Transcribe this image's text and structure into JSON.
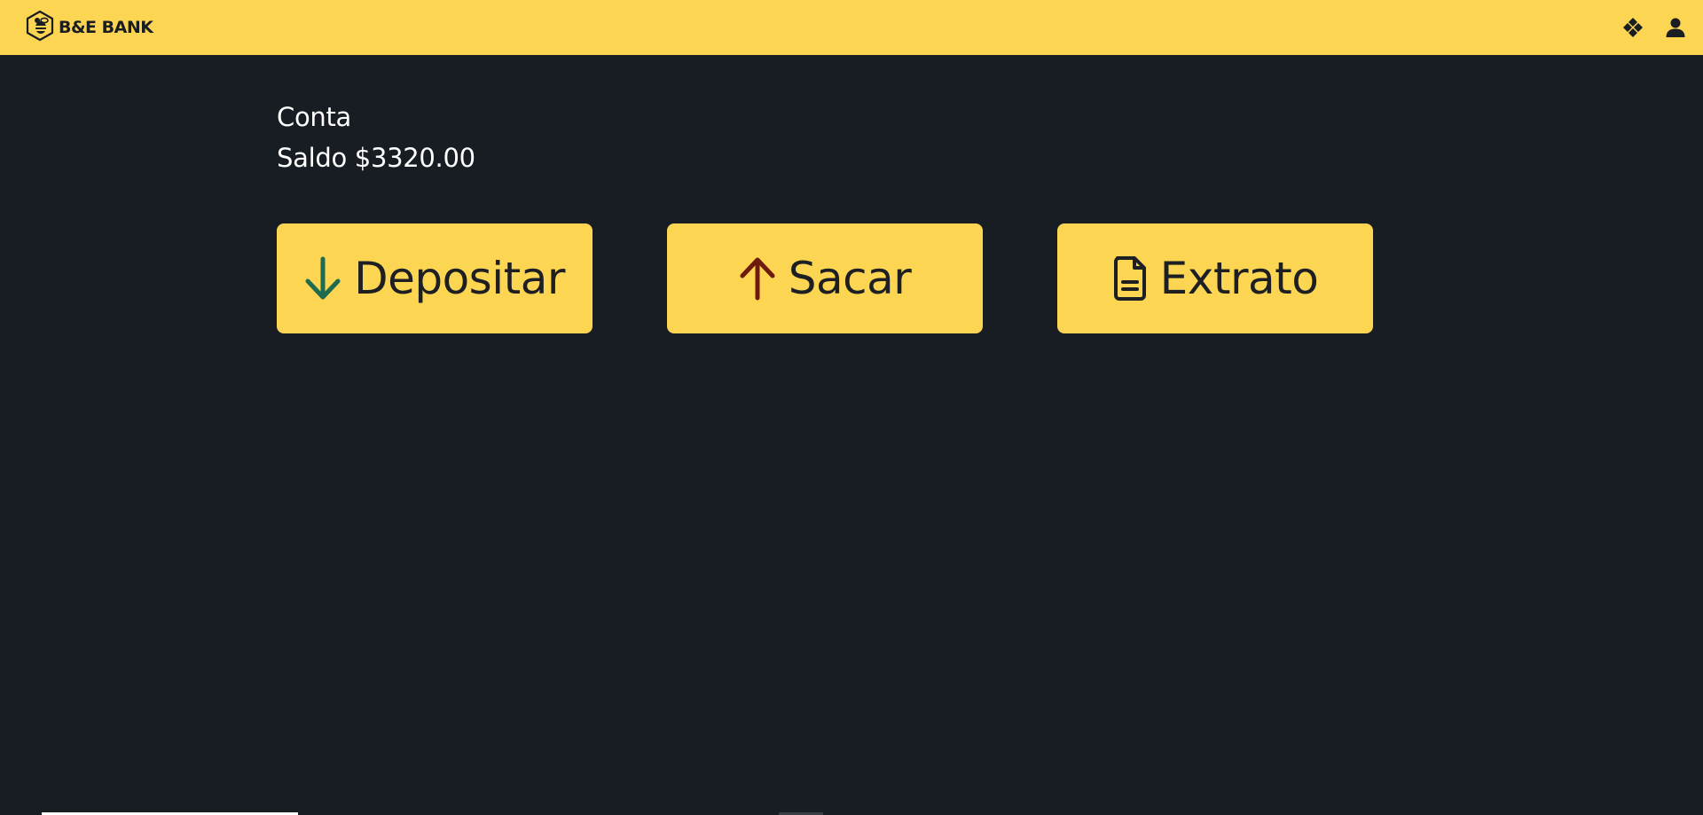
{
  "navbar": {
    "brand_text": "B&E BANK",
    "icons": [
      "diamonds-icon",
      "user-icon"
    ]
  },
  "account": {
    "title": "Conta",
    "balance_label": "Saldo $3320.00"
  },
  "actions": [
    {
      "label": "Depositar",
      "icon": "arrow-down-icon",
      "icon_color": "#1f6b4f"
    },
    {
      "label": "Sacar",
      "icon": "arrow-up-icon",
      "icon_color": "#6e1a0d"
    },
    {
      "label": "Extrato",
      "icon": "document-icon",
      "icon_color": "#1d1f23"
    }
  ],
  "colors": {
    "background": "#181d24",
    "accent": "#fcd653",
    "text_dark": "#1d1f23",
    "text_light": "#ffffff"
  }
}
